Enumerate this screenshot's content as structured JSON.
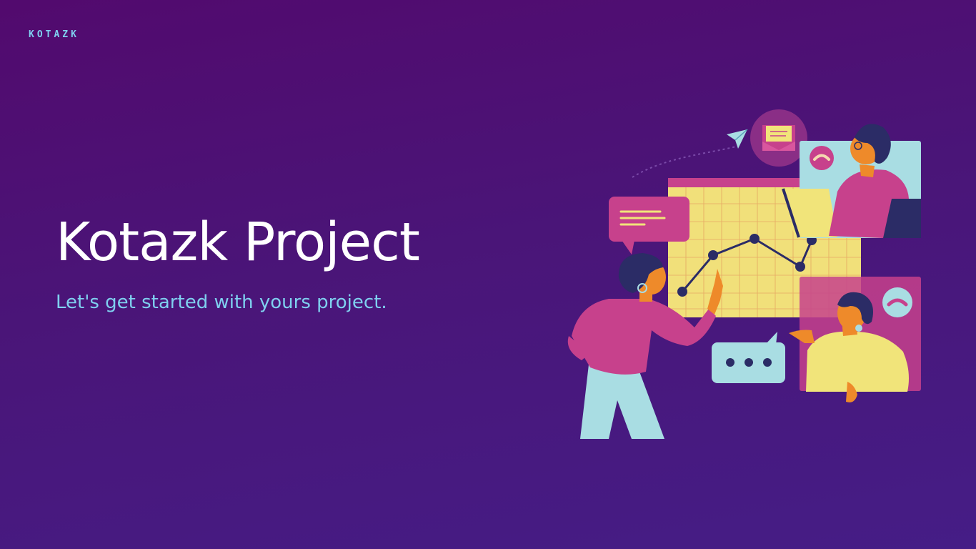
{
  "brand": {
    "name": "KOTAZK"
  },
  "hero": {
    "title": "Kotazk Project",
    "subtitle": "Let's get started with yours project."
  },
  "illustration": {
    "icons": [
      "paper-plane-icon",
      "mail-icon",
      "message-bubble-icon",
      "typing-bubble-icon",
      "phone-icon",
      "line-chart"
    ]
  },
  "colors": {
    "background_start": "#520a6e",
    "background_end": "#451d86",
    "accent": "#7fd0ef",
    "title": "#ffffff",
    "pink": "#c7418c",
    "yellow": "#f1e47a",
    "light_blue": "#a9dde3",
    "navy": "#2b2c66",
    "orange": "#ee8a2a"
  }
}
